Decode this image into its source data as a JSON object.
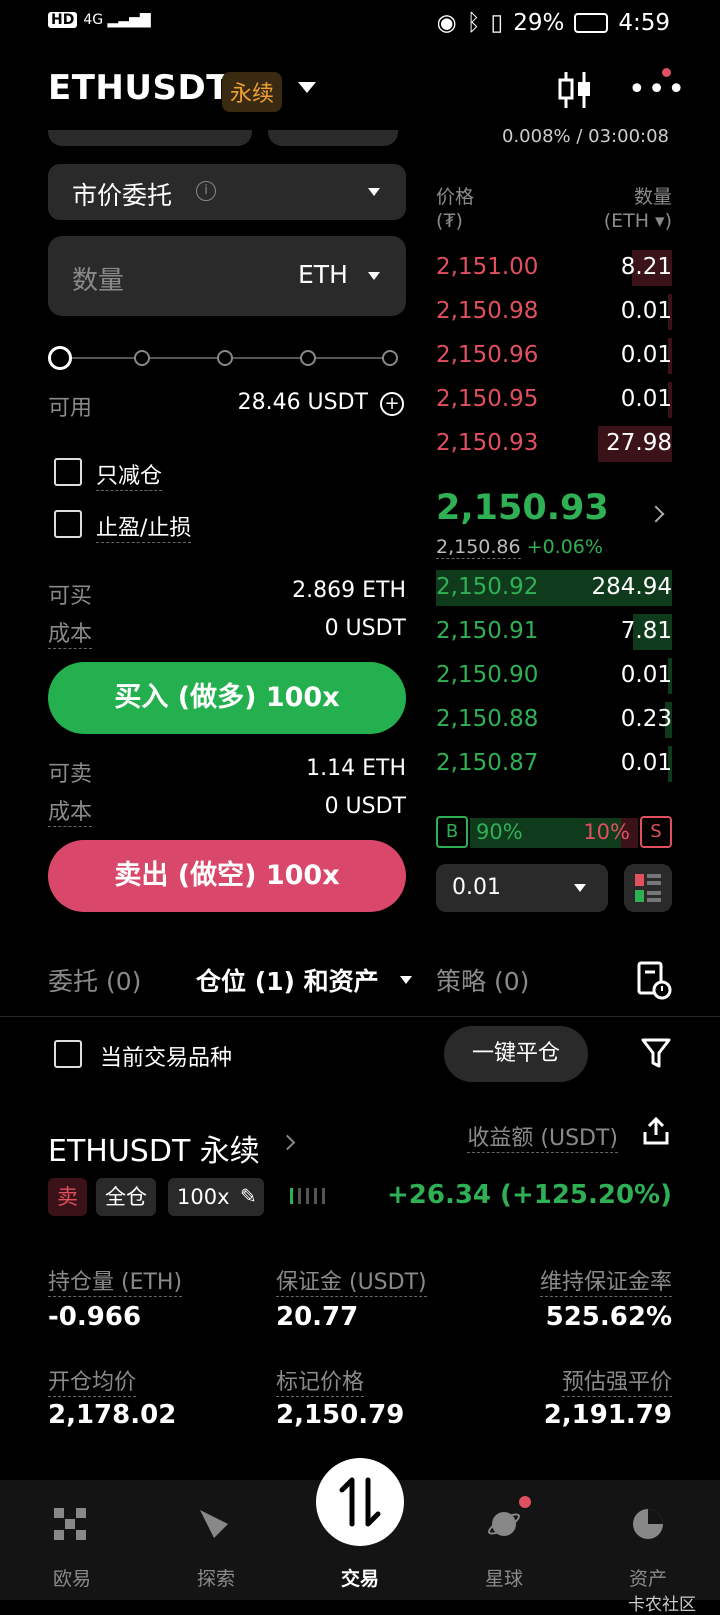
{
  "status_bar": {
    "left": "HD 4G",
    "battery": "29%",
    "time": "4:59"
  },
  "header": {
    "symbol": "ETHUSDT",
    "badge": "永续"
  },
  "funding_fragment": "0.008% / 03:00:08",
  "order_form": {
    "order_type": "市价委托",
    "quantity_placeholder": "数量",
    "quantity_unit": "ETH",
    "available_label": "可用",
    "available_value": "28.46 USDT",
    "reduce_only": "只减仓",
    "tp_sl": "止盈/止损",
    "buyable_label": "可买",
    "buyable_value": "2.869 ETH",
    "cost_label": "成本",
    "buy_cost_value": "0 USDT",
    "buy_button": "买入 (做多) 100x",
    "sellable_label": "可卖",
    "sellable_value": "1.14 ETH",
    "sell_cost_value": "0 USDT",
    "sell_button": "卖出 (做空) 100x"
  },
  "order_book": {
    "price_header": "价格",
    "price_unit": "(₮)",
    "qty_header": "数量",
    "qty_unit": "(ETH ▾)",
    "asks": [
      {
        "price": "2,151.00",
        "qty": "8.21"
      },
      {
        "price": "2,150.98",
        "qty": "0.01"
      },
      {
        "price": "2,150.96",
        "qty": "0.01"
      },
      {
        "price": "2,150.95",
        "qty": "0.01"
      },
      {
        "price": "2,150.93",
        "qty": "27.98"
      }
    ],
    "last_price": "2,150.93",
    "mark_price": "2,150.86",
    "change": "+0.06%",
    "bids": [
      {
        "price": "2,150.92",
        "qty": "284.94"
      },
      {
        "price": "2,150.91",
        "qty": "7.81"
      },
      {
        "price": "2,150.90",
        "qty": "0.01"
      },
      {
        "price": "2,150.88",
        "qty": "0.23"
      },
      {
        "price": "2,150.87",
        "qty": "0.01"
      }
    ],
    "buy_ratio_label": "B",
    "buy_ratio": "90%",
    "sell_ratio_label": "S",
    "sell_ratio": "10%",
    "buy_fraction": 0.9,
    "depth_step": "0.01"
  },
  "tabs": {
    "orders": "委托 (0)",
    "positions": "仓位 (1) 和资产",
    "strategies": "策略 (0)"
  },
  "filter": {
    "current_symbol": "当前交易品种",
    "close_all": "一键平仓"
  },
  "position": {
    "title": "ETHUSDT 永续",
    "pnl_label": "收益额 (USDT)",
    "side": "卖",
    "margin_mode": "全仓",
    "leverage": "100x",
    "pnl_value": "+26.34 (+125.20%)",
    "size_label": "持仓量 (ETH)",
    "size_value": "-0.966",
    "margin_label": "保证金 (USDT)",
    "margin_value": "20.77",
    "mmr_label": "维持保证金率",
    "mmr_value": "525.62%",
    "entry_label": "开仓均价",
    "entry_value": "2,178.02",
    "mark_label": "标记价格",
    "mark_value": "2,150.79",
    "liq_label": "预估强平价",
    "liq_value": "2,191.79"
  },
  "nav": {
    "items": [
      "欧易",
      "探索",
      "交易",
      "星球",
      "资产"
    ],
    "watermark": "卡农社区"
  },
  "colors": {
    "buy": "#25b04f",
    "sell": "#d9486a",
    "accent_badge": "#f0a030"
  }
}
